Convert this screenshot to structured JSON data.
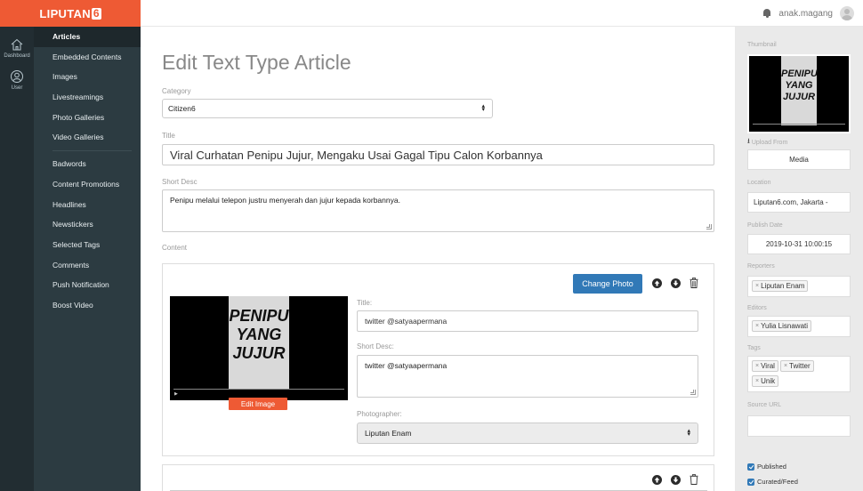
{
  "header": {
    "logo_text": "LIPUTAN",
    "logo_number": "6",
    "username": "anak.magang"
  },
  "rail": {
    "items": [
      {
        "label": "Dashboard",
        "icon": "home-icon"
      },
      {
        "label": "User",
        "icon": "user-icon"
      }
    ]
  },
  "nav": {
    "items": [
      "Articles",
      "Embedded Contents",
      "Images",
      "Livestreamings",
      "Photo Galleries",
      "Video Galleries",
      "Badwords",
      "Content Promotions",
      "Headlines",
      "Newstickers",
      "Selected Tags",
      "Comments",
      "Push Notification",
      "Boost Video"
    ],
    "active": "Articles"
  },
  "main": {
    "title": "Edit Text Type Article",
    "category_label": "Category",
    "category_value": "Citizen6",
    "title_label": "Title",
    "title_value": "Viral Curhatan Penipu Jujur, Mengaku Usai Gagal Tipu Calon Korbannya",
    "short_desc_label": "Short Desc",
    "short_desc_value": "Penipu melalui telepon justru menyerah dan jujur kepada korbannya.",
    "content_label": "Content"
  },
  "photo_block": {
    "change_photo_label": "Change Photo",
    "image_text": [
      "PENIPU",
      "YANG",
      "JUJUR"
    ],
    "edit_image_label": "Edit Image",
    "title_label": "Title:",
    "title_value": "twitter @satyaapermana",
    "short_desc_label": "Short Desc:",
    "short_desc_value": "twitter @satyaapermana",
    "photographer_label": "Photographer:",
    "photographer_value": "Liputan Enam"
  },
  "sidebar_right": {
    "thumbnail_label": "Thumbnail",
    "upload_from_label": "Upload From",
    "upload_value": "Media",
    "location_label": "Location",
    "location_value": "Liputan6.com, Jakarta -",
    "publish_date_label": "Publish Date",
    "publish_date_value": "2019-10-31 10:00:15",
    "reporters_label": "Reporters",
    "reporters": [
      "Liputan Enam"
    ],
    "editors_label": "Editors",
    "editors": [
      "Yulia Lisnawati"
    ],
    "tags_label": "Tags",
    "tags": [
      "Viral",
      "Twitter",
      "Unik"
    ],
    "source_url_label": "Source URL",
    "published_label": "Published",
    "curated_label": "Curated/Feed"
  },
  "colors": {
    "brand": "#ee5a34",
    "button_blue": "#3179b7",
    "sidebar_dark": "#2c3b41"
  }
}
